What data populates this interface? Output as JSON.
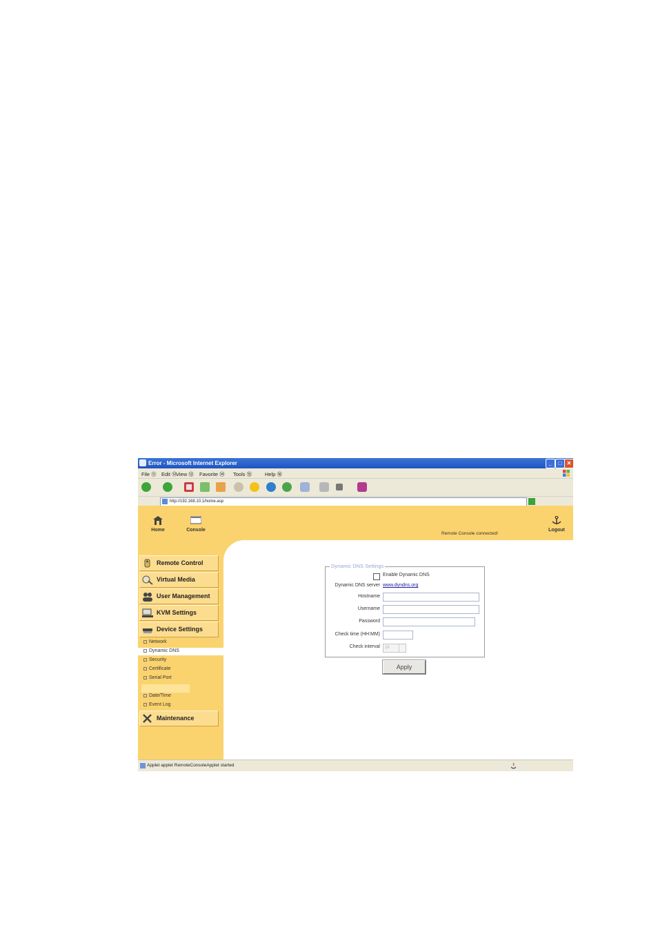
{
  "window": {
    "title": "Error - Microsoft Internet Explorer",
    "controls": [
      "_",
      "□",
      "✕"
    ]
  },
  "menubar": {
    "items": [
      "File ⑪",
      "Edit ⑫",
      "View ⑬",
      "Favorite ⑭",
      "Tools ⑮",
      "Help ⑯"
    ]
  },
  "addressbar": {
    "url": "http://192.168.10.1/home.asp"
  },
  "header": {
    "nav": [
      {
        "label": "Home",
        "icon": "home-icon"
      },
      {
        "label": "Console",
        "icon": "console-icon"
      },
      {
        "label": "Logout",
        "icon": "logout-icon"
      }
    ],
    "status": "Remote Console connected!"
  },
  "sidebar": {
    "menus": [
      {
        "label": "Remote Control",
        "icon": "remote-control-icon"
      },
      {
        "label": "Virtual Media",
        "icon": "virtual-media-icon"
      },
      {
        "label": "User Management",
        "icon": "user-management-icon"
      },
      {
        "label": "KVM Settings",
        "icon": "kvm-settings-icon"
      },
      {
        "label": "Device Settings",
        "icon": "device-settings-icon"
      }
    ],
    "subitems": [
      "Network",
      "Dynamic DNS",
      "Security",
      "Certificate",
      "Serial Port",
      "Date/Time",
      "Event Log"
    ],
    "active_subitem": "Dynamic DNS",
    "maintenance": {
      "label": "Maintenance",
      "icon": "maintenance-icon"
    }
  },
  "form": {
    "legend": "Dynamic DNS Settings",
    "enable_label": "Enable Dynamic DNS",
    "server_label": "Dynamic DNS server",
    "server_link": "www.dyndns.org",
    "hostname_label": "Hostname",
    "username_label": "Username",
    "password_label": "Password",
    "checktime_label": "Check time (HH:MM)",
    "checkinterval_label": "Check interval",
    "checkinterval_value": "1h",
    "apply_label": "Apply"
  },
  "statusbar": {
    "text": "Applet applet RemoteConsoleApplet started"
  },
  "colors": {
    "page_accent": "#fbd36e",
    "titlebar": "#1f54c2",
    "chrome": "#ece9d8",
    "legend": "#96a7d1"
  }
}
